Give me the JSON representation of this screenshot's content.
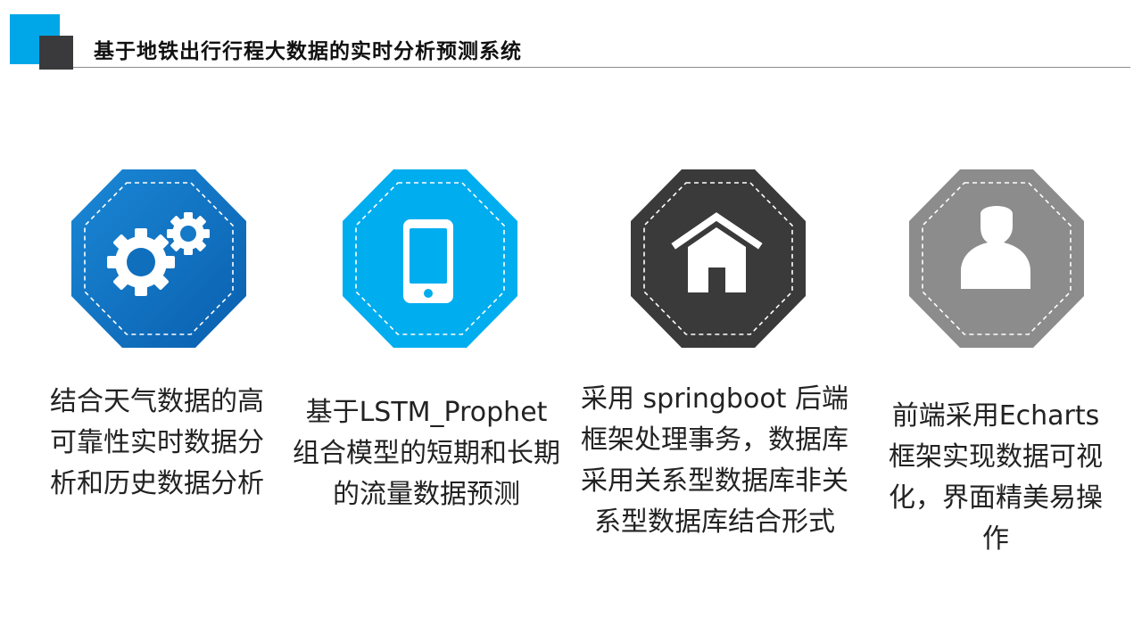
{
  "header": {
    "title": "基于地铁出行行程大数据的实时分析预测系统",
    "accent_color": "#00a7e8",
    "dark_color": "#3a3a3c"
  },
  "cards": [
    {
      "icon": "gears-icon",
      "color": "#0e73c2",
      "description": "结合天气数据的高可靠性实时数据分析和历史数据分析"
    },
    {
      "icon": "smartphone-icon",
      "color": "#00adef",
      "description": "基于LSTM_Prophet组合模型的短期和长期的流量数据预测"
    },
    {
      "icon": "home-icon",
      "color": "#3a3a3a",
      "description": "采用 springboot 后端框架处理事务，数据库采用关系型数据库非关系型数据库结合形式"
    },
    {
      "icon": "user-icon",
      "color": "#8c8c8c",
      "description": "前端采用Echarts框架实现数据可视化，界面精美易操作"
    }
  ]
}
